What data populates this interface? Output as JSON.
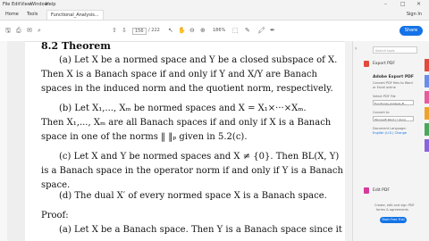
{
  "menu": [
    "File",
    "Edit",
    "View",
    "Window",
    "Help"
  ],
  "tabs": [
    "Home",
    "Tools",
    "Functional_Analysis..."
  ],
  "signin": "Sign In",
  "toolbar": {
    "page_current": "156",
    "page_total": "/ 222",
    "zoom": "186%",
    "share_label": "Share"
  },
  "document": {
    "lines": [
      "8.2 Theorem",
      "(a) Let X be a normed space and Y be a closed subspace of X.",
      "Then X is a Banach space if and only if Y and X/Y are Banach",
      "spaces in the induced norm and the quotient norm, respectively.",
      "(b) Let X₁,..., Xₘ be normed spaces and X = X₁×···×Xₘ.",
      "Then X₁,..., Xₘ are all Banach spaces if and only if X is a Banach",
      "space in one of the norms ‖ ‖ₚ given in 5.2(c).",
      "(c) Let X and Y be normed spaces and X ≠ {0}. Then BL(X, Y)",
      "is a Banach space in the operator norm if and only if Y is a Banach",
      "space.",
      "(d) The dual X′ of every normed space X is a Banach space.",
      "Proof:",
      "(a) Let X be a Banach space. Then Y is a Banach space since it"
    ]
  },
  "right_panel": {
    "search_placeholder": "Search tools",
    "export_pdf": "Export PDF",
    "adobe_export": "Adobe Export PDF",
    "adobe_sub1": "Convert PDF files to Word",
    "adobe_sub2": "or Excel online",
    "select_file_label": "Select PDF File",
    "file_name": "Functional_Analysis_B...",
    "convert_to_label": "Convert to",
    "convert_to_value": "Microsoft Word (*.docx)",
    "doc_lang_label": "Document Language:",
    "doc_lang_value": "English (U.S.) Change",
    "edit_pdf": "Edit PDF",
    "promo1": "Create, edit and sign PDF",
    "promo2": "forms & agreements",
    "trial_button": "Start Free Trial"
  },
  "colors": {
    "accent": "#1473e6",
    "export_icon": "#e24b3c",
    "edit_icon": "#d63a9c"
  }
}
